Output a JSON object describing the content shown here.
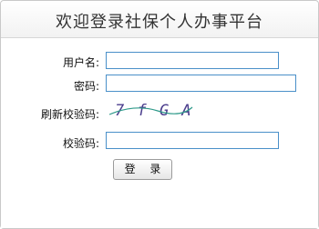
{
  "header": {
    "title": "欢迎登录社保个人办事平台"
  },
  "form": {
    "username_label": "用户名:",
    "username_value": "",
    "password_label": "密码:",
    "password_value": "",
    "refresh_captcha_label": "刷新校验码:",
    "captcha_text": "7 f G A",
    "captcha_color": "#4a3c8c",
    "verify_label": "校验码:",
    "verify_value": ""
  },
  "buttons": {
    "login_label": "登 录"
  },
  "colors": {
    "input_border": "#4a90c9",
    "panel_border": "#c9c9c9"
  }
}
